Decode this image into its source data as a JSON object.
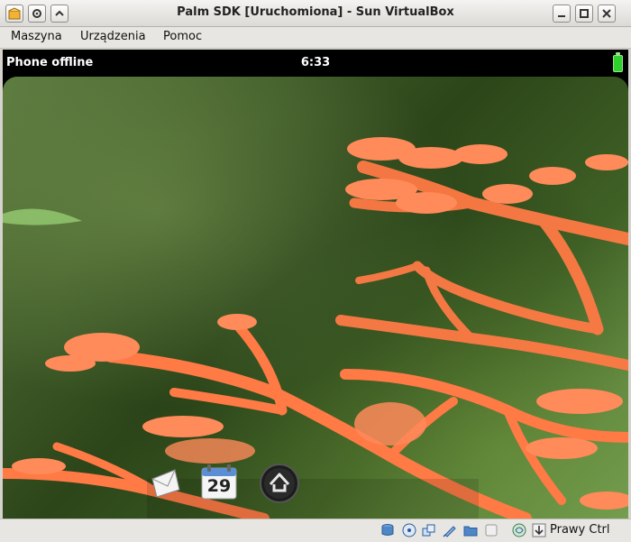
{
  "window": {
    "title": "Palm SDK [Uruchomiona] - Sun VirtualBox"
  },
  "menubar": {
    "items": [
      {
        "label": "Maszyna"
      },
      {
        "label": "Urządzenia"
      },
      {
        "label": "Pomoc"
      }
    ]
  },
  "device": {
    "status": {
      "network": "Phone offline",
      "clock": "6:33"
    },
    "dock": {
      "calendar_day": "29"
    }
  },
  "vbox_status": {
    "host_key": "Prawy Ctrl"
  },
  "colors": {
    "accent": "#ff7a45",
    "battery": "#2fd12f"
  }
}
